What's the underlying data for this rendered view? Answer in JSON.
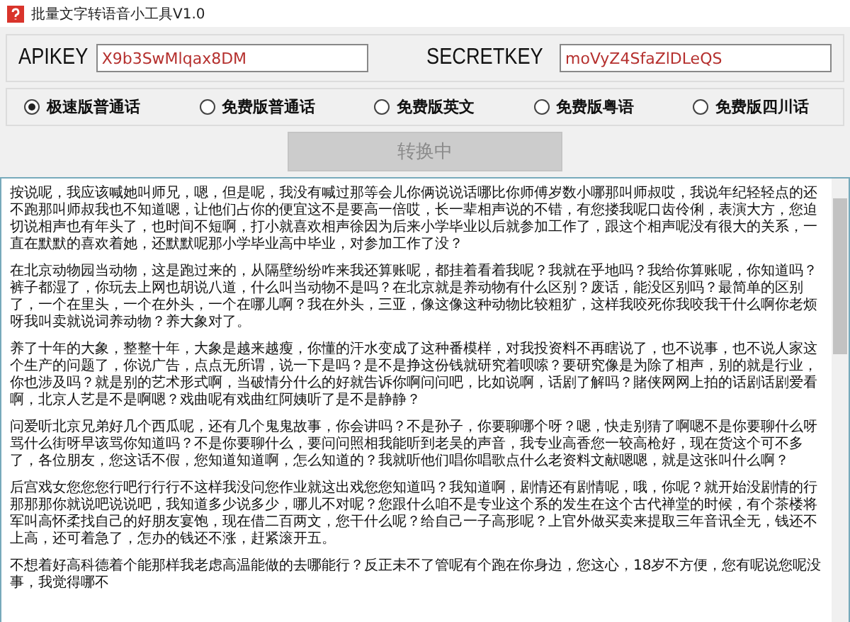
{
  "window": {
    "title": "批量文字转语音小工具V1.0"
  },
  "keys": [
    {
      "label": "APIKEY",
      "value": "X9b3SwMlqax8DM"
    },
    {
      "label": "SECRETKEY",
      "value": "moVyZ4SfaZlDLeQS"
    }
  ],
  "voices": [
    {
      "label": "极速版普通话",
      "selected": true
    },
    {
      "label": "免费版普通话",
      "selected": false
    },
    {
      "label": "免费版英文",
      "selected": false
    },
    {
      "label": "免费版粤语",
      "selected": false
    },
    {
      "label": "免费版四川话",
      "selected": false
    }
  ],
  "convert_button": {
    "label": "转换中",
    "disabled": true
  },
  "paragraphs": [
    "按说呢，我应该喊她叫师兄，嗯，但是呢，我没有喊过那等会儿你俩说说话哪比你师傅岁数小哪那叫师叔哎，我说年纪轻轻点的还不跑那叫师叔我也不知道嗯，让他们占你的便宜这不是要高一倍哎，长一辈相声说的不错，有您搂我呢口齿伶俐，表演大方，您迫切说相声也有年头了，也时间不短啊，打小就喜欢相声徐因为后来小学毕业以后就参加工作了，跟这个相声呢没有很大的关系，一直在默默的喜欢着她，还默默呢那小学毕业高中毕业，对参加工作了没？",
    "在北京动物园当动物，这是跑过来的，从隔壁纷纷咋来我还算账呢，都挂着看着我呢？我就在乎地吗？我给你算账呢，你知道吗？裤子都湿了，你玩去上网也胡说八道，什么叫当动物不是吗？在北京就是养动物有什么区别？废话，能没区别吗？最简单的区别了，一个在里头，一个在外头，一个在哪儿啊？我在外头，三亚，像这像这种动物比较粗犷，这样我咬死你我咬我干什么啊你老烦呀我叫卖就说词养动物？养大象对了。",
    "养了十年的大象，整整十年，大象是越来越瘦，你懂的汗水变成了这种番模样，对我投资料不再瞎说了，也不说事，也不说人家这个生产的问题了，你说广告，点点无所谓，说一下是吗？是不是挣这份钱就研究着呗嗦？要研究像是为除了相声，别的就是行业，你也涉及吗？就是别的艺术形式啊，当破情分什么的好就告诉你啊问问吧，比如说啊，话剧了解吗？賭侠网网上拍的话剧话剧爱看啊，北京人艺是不是啊嗯？戏曲呢有戏曲红阿姨听了是不是静静？",
    "问爱听北京兄弟好几个西瓜呢，还有几个鬼鬼故事，你会讲吗？不是孙子，你要聊哪个呀？嗯，快走别猜了啊嗯不是你要聊什么呀骂什么街呀早该骂你知道吗？不是你要聊什么，要问问照相我能听到老吴的声音，我专业高香您一较高枪好，现在货这个可不多了，各位朋友，您这话不假，您知道知道啊，怎么知道的？我就听他们唱你唱歌点什么老资料文献嗯嗯，就是这张叫什么啊？",
    "后宫戏女您您您行吧行行行不这样我没问您作业就这出戏您您知道吗？我知道啊，剧情还有剧情呢，哦，你呢？就开始没剧情的行那那那你就说吧说说吧，我知道多少说多少，哪儿不对呢？您跟什么咱不是专业这个系的发生在这个古代禅堂的时候，有个茶楼将军叫高怀柔找自己的好朋友宴饱，现在借二百两文，您干什么呢？给自己一子高形呢？上官外做买卖来提取三年音讯全无，钱还不上高，还可着急了，怎办的钱还不涨，赶紧滚开五。",
    "不想着好高科德着个能那样我老虑高温能做的去哪能行？反正未不了管呢有个跑在你身边，您这心，18岁不方便，您有呢说您呢没事，我觉得哪不"
  ]
}
